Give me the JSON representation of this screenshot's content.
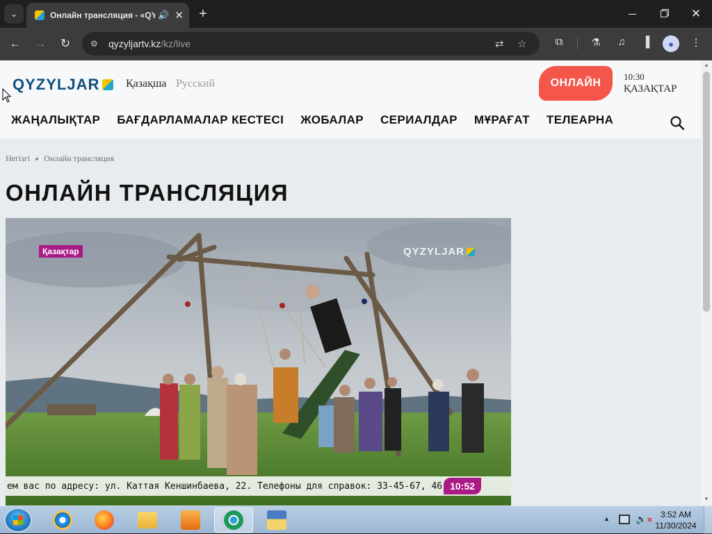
{
  "browser": {
    "tab_title": "Онлайн трансляция - «QY",
    "url_domain": "qyzyljartv.kz",
    "url_path": "/kz/live"
  },
  "site": {
    "logo": "QYZYLJAR",
    "lang_active": "Қазақша",
    "lang_other": "Русский",
    "online_button": "ОНЛАЙН",
    "schedule_time": "10:30",
    "schedule_show": "ҚАЗАҚТАР",
    "nav": [
      "ЖАҢАЛЫҚТАР",
      "БАҒДАРЛАМАЛАР КЕСТЕСІ",
      "ЖОБАЛАР",
      "СЕРИАЛДАР",
      "МҰРАҒАТ",
      "ТЕЛЕАРНА"
    ]
  },
  "breadcrumb": {
    "home": "Негізгі",
    "current": "Онлайн трансляция"
  },
  "page_title": "ОНЛАЙН ТРАНСЛЯЦИЯ",
  "video": {
    "channel_badge": "Қазақтар",
    "channel_logo": "QYZYLJAR",
    "ticker": "ем вас  по адресу: ул. Каттая Кеншинбаева, 22. Телефоны для справок: 33-45-67, 46",
    "clock": "10:52"
  },
  "taskbar": {
    "time": "3:52 AM",
    "date": "11/30/2024"
  },
  "colors": {
    "accent": "#f4574a",
    "brand_blue": "#0f4f7f",
    "badge_magenta": "#a91a86"
  }
}
